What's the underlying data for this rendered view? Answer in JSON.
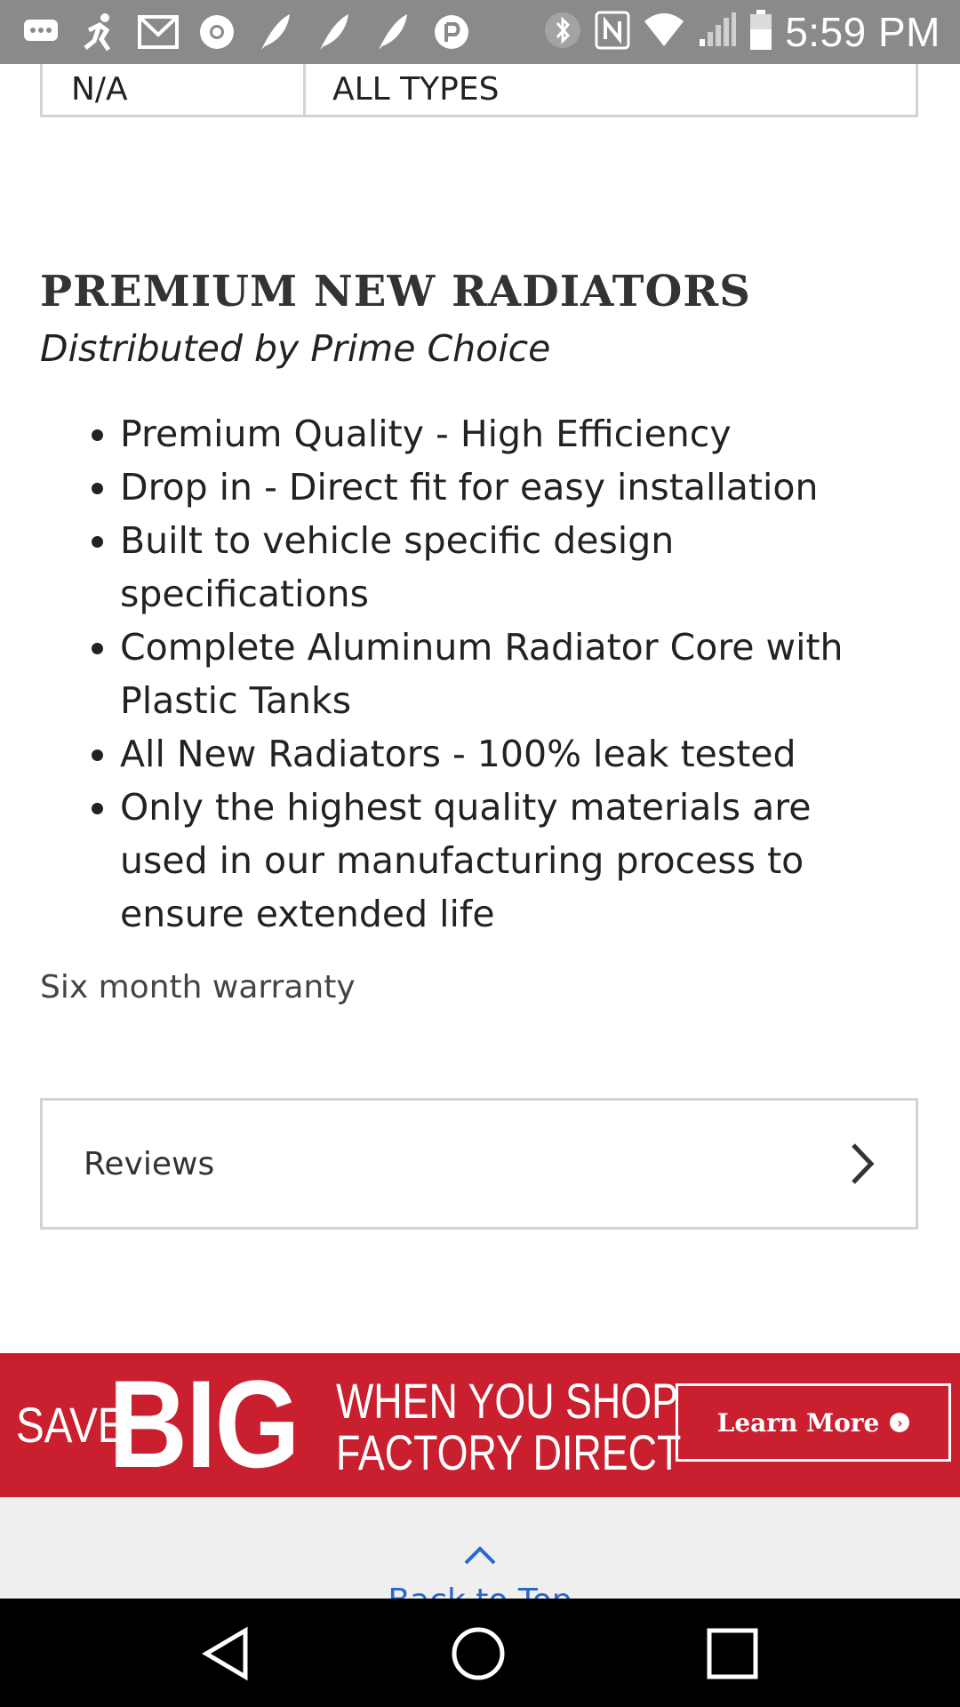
{
  "status_bar": {
    "time": "5:59 PM",
    "left_icons": [
      "message-icon",
      "running-icon",
      "gmail-icon",
      "chrome-icon",
      "feather-icon",
      "feather-icon",
      "feather-icon",
      "pandora-icon"
    ],
    "right_icons": [
      "bluetooth-icon",
      "nfc-icon",
      "wifi-icon",
      "signal-icon",
      "battery-icon"
    ]
  },
  "spec_table": {
    "row": [
      "N/A",
      "ALL TYPES"
    ]
  },
  "product": {
    "title": "PREMIUM NEW RADIATORS",
    "subtitle": "Distributed by Prime Choice",
    "features": [
      "Premium Quality - High Efficiency",
      "Drop in - Direct fit for easy installation",
      "Built to vehicle specific design specifications",
      "Complete Aluminum Radiator Core with Plastic Tanks",
      "All New Radiators - 100% leak tested",
      "Only the highest quality materials are used in our manufacturing process to ensure extended life"
    ],
    "warranty": "Six month warranty"
  },
  "reviews": {
    "label": "Reviews"
  },
  "banner": {
    "save": "SAVE",
    "big": "BIG",
    "line1": "WHEN YOU SHOP",
    "line2": "FACTORY DIRECT",
    "cta": "Learn More",
    "color": "#c91f2e"
  },
  "footer": {
    "back_to_top": "Back to Top"
  },
  "nav_bar": {
    "buttons": [
      "back-icon",
      "home-icon",
      "recents-icon"
    ]
  }
}
